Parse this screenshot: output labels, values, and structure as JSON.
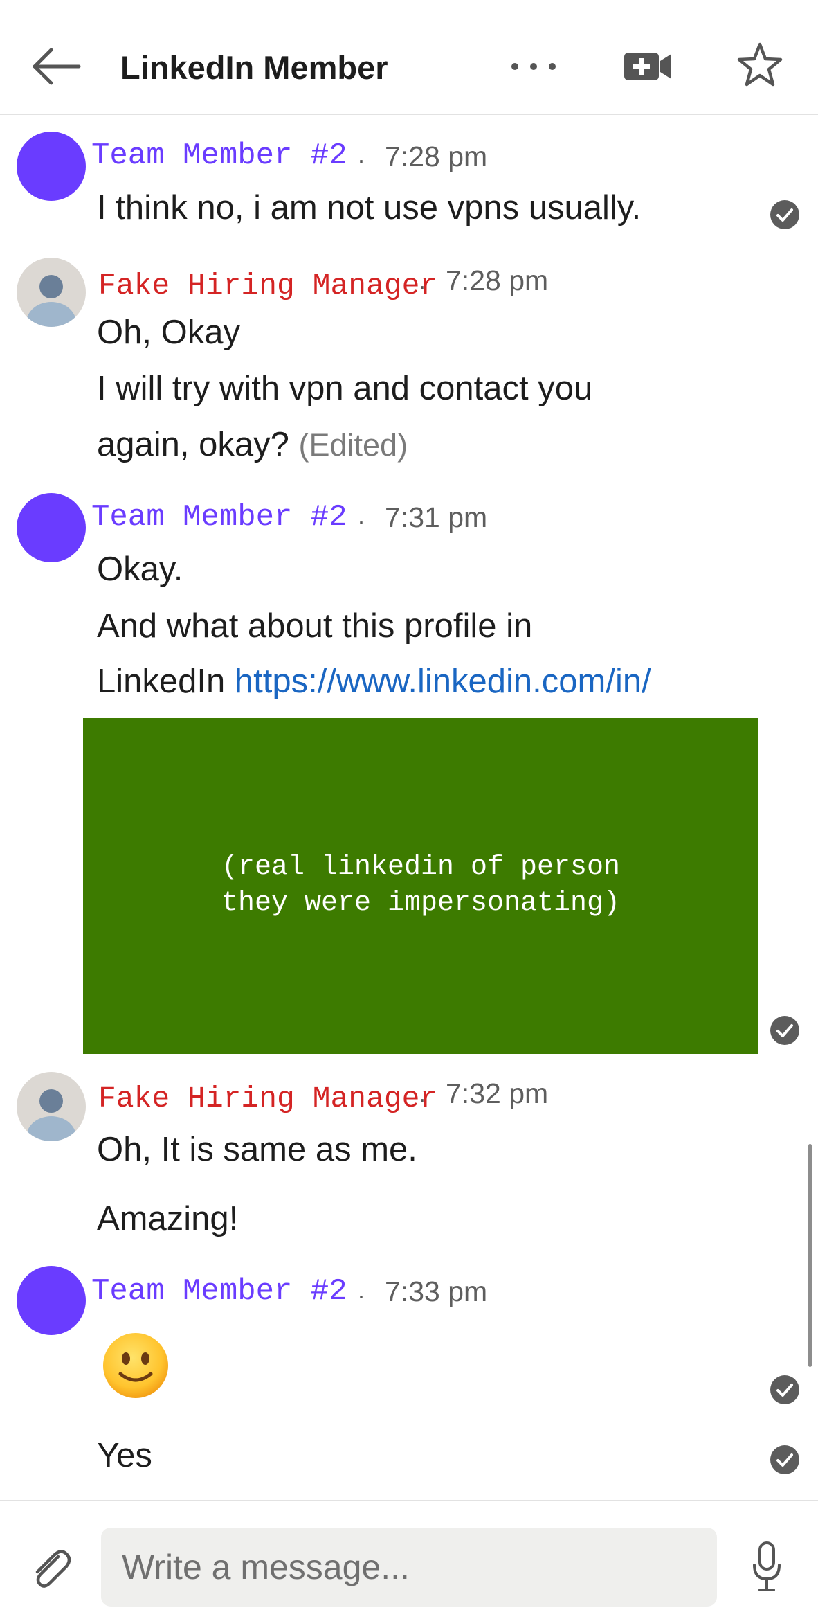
{
  "header": {
    "title": "LinkedIn Member",
    "back_icon": "arrow-left-icon",
    "more_icon": "more-horizontal-icon",
    "video_icon": "video-call-icon",
    "star_icon": "star-icon"
  },
  "messages": [
    {
      "sender": "Team Member #2",
      "time": "7:28 pm",
      "lines": [
        "I think no, i am not use vpns usually."
      ]
    },
    {
      "sender": "Fake Hiring Manager",
      "time": "7:28 pm",
      "lines": [
        "Oh, Okay",
        "I will  try with vpn and contact you",
        "again, okay?"
      ],
      "edited": "(Edited)"
    },
    {
      "sender": "Team Member #2",
      "time": "7:31 pm",
      "lines": [
        "Okay.",
        "And what about this profile in",
        "LinkedIn "
      ],
      "link": "https://www.linkedin.com/in/",
      "preview": "(real linkedin of person\nthey were impersonating)"
    },
    {
      "sender": "Fake Hiring Manager",
      "time": "7:32 pm",
      "lines": [
        "Oh, It is same as me.",
        "Amazing!"
      ]
    },
    {
      "sender": "Team Member #2",
      "time": "7:33 pm",
      "emoji": "slightly-smiling-face-emoji",
      "lines": [
        "Yes"
      ]
    }
  ],
  "separator": "·",
  "composer": {
    "placeholder": "Write a message...",
    "attach_icon": "paperclip-icon",
    "mic_icon": "microphone-icon"
  },
  "colors": {
    "team_member": "#6a3cff",
    "fake_hiring_manager": "#d42424",
    "link": "#1a66c2",
    "preview_bg": "#3d7b00"
  }
}
